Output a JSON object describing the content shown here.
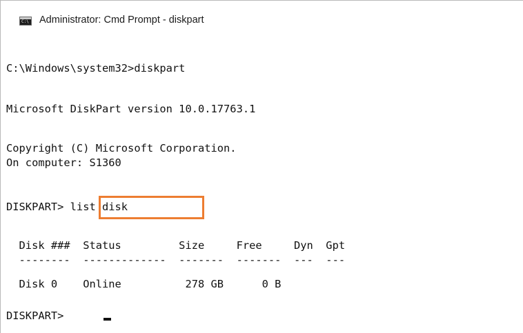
{
  "window": {
    "title": "Administrator: Cmd Prompt - diskpart",
    "icon": "cmd-console-icon",
    "icon_text": "C:\\"
  },
  "console": {
    "lines": [
      "C:\\Windows\\system32>diskpart",
      "Microsoft DiskPart version 10.0.17763.1",
      "Copyright (C) Microsoft Corporation.",
      "On computer: S1360",
      "DISKPART> list disk",
      "  Disk ###  Status         Size     Free     Dyn  Gpt",
      "  --------  -------------  -------  -------  ---  ---",
      "  Disk 0    Online          278 GB      0 B",
      "DISKPART> "
    ],
    "highlighted_command": "list disk",
    "highlight_color": "#ed7d31"
  }
}
